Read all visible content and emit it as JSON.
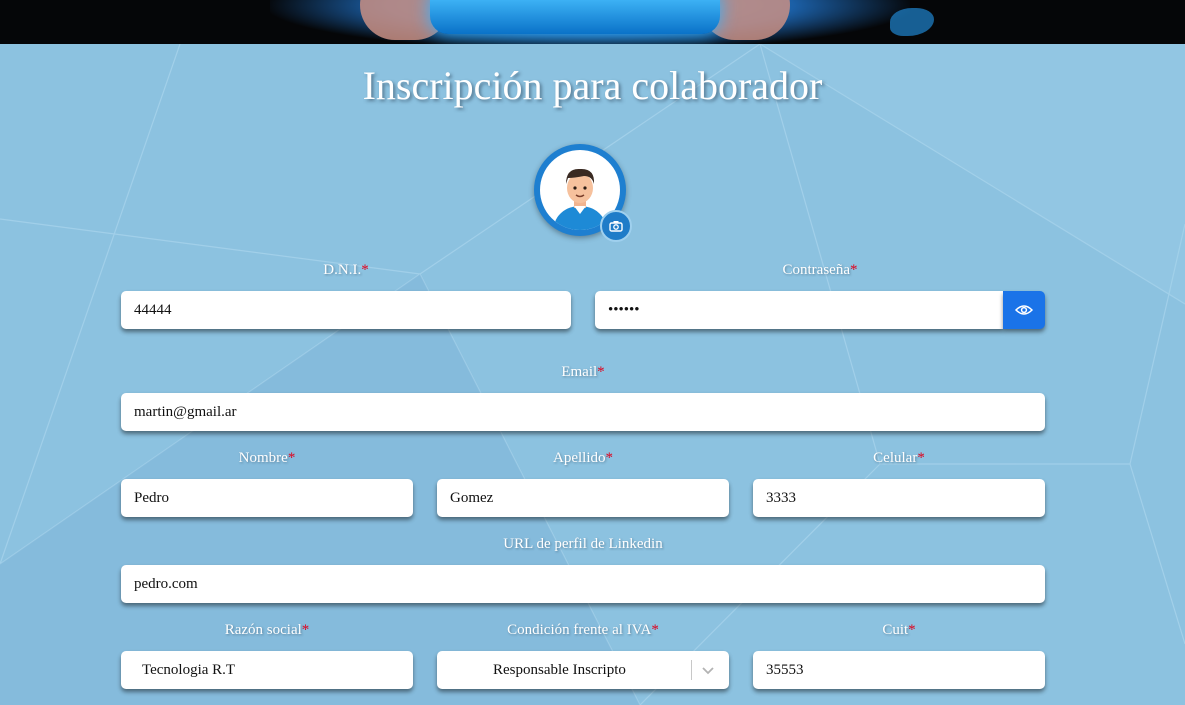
{
  "page": {
    "title": "Inscripción para colaborador",
    "required_marker": "*"
  },
  "avatar": {
    "icon": "user-avatar-icon",
    "upload_icon": "camera-icon"
  },
  "form": {
    "dni": {
      "label": "D.N.I.",
      "value": "44444"
    },
    "password": {
      "label": "Contraseña",
      "value": "••••••",
      "toggle_icon": "eye-icon"
    },
    "email": {
      "label": "Email",
      "value": "martin@gmail.ar"
    },
    "nombre": {
      "label": "Nombre",
      "value": "Pedro"
    },
    "apellido": {
      "label": "Apellido",
      "value": "Gomez"
    },
    "celular": {
      "label": "Celular",
      "value": "3333"
    },
    "linkedin": {
      "label": "URL de perfil de Linkedin",
      "value": "pedro.com"
    },
    "razon_social": {
      "label": "Razón social",
      "value": "Tecnologia R.T"
    },
    "condicion_iva": {
      "label": "Condición frente al IVA",
      "value": "Responsable Inscripto"
    },
    "cuit": {
      "label": "Cuit",
      "value": "35553"
    }
  },
  "colors": {
    "background": "#8cc2e0",
    "accent": "#1a73e8",
    "required": "#e0001b"
  }
}
